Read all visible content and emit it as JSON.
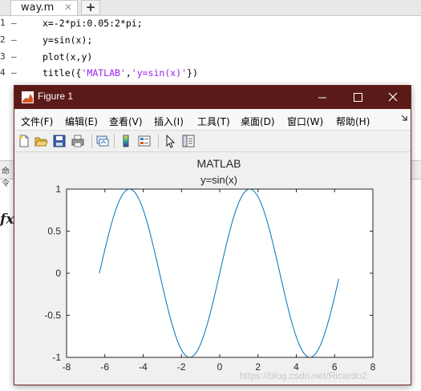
{
  "editor": {
    "tab": {
      "label": "way.m",
      "close": "✕",
      "add": "+"
    },
    "lines": [
      {
        "num": "1",
        "dash": "–",
        "code": "x=-2*pi:0.05:2*pi;"
      },
      {
        "num": "2",
        "dash": "–",
        "code": "y=sin(x);"
      },
      {
        "num": "3",
        "dash": "–",
        "code": "plot(x,y)"
      },
      {
        "num": "4",
        "dash": "–",
        "code_pre": "title({",
        "code_str1": "'MATLAB'",
        "code_mid": ",",
        "code_str2": "'y=sin(x)'",
        "code_post": "})"
      }
    ],
    "command_label": "命令",
    "fx": "fx"
  },
  "figure": {
    "title": "Figure 1",
    "menu": [
      "文件(F)",
      "编辑(E)",
      "查看(V)",
      "插入(I)",
      "工具(T)",
      "桌面(D)",
      "窗口(W)",
      "帮助(H)"
    ],
    "toolbar_icons": [
      "new-figure-icon",
      "open-file-icon",
      "save-icon",
      "print-icon",
      "link-plot-icon",
      "insert-colorbar-icon",
      "insert-legend-icon",
      "select-arrow-icon",
      "property-inspector-icon"
    ],
    "colors": {
      "titlebar": "#5a1a17",
      "line": "#0072bd"
    }
  },
  "chart_data": {
    "type": "line",
    "title": [
      "MATLAB",
      "y=sin(x)"
    ],
    "xlabel": "",
    "ylabel": "",
    "xlim": [
      -8,
      8
    ],
    "ylim": [
      -1,
      1
    ],
    "x_ticks": [
      -8,
      -6,
      -4,
      -2,
      0,
      2,
      4,
      6,
      8
    ],
    "y_ticks": [
      -1,
      -0.5,
      0,
      0.5,
      1
    ],
    "x_tick_labels": [
      "-8",
      "-6",
      "-4",
      "-2",
      "0",
      "2",
      "4",
      "6",
      "8"
    ],
    "y_tick_labels": [
      "-1",
      "-0.5",
      "0",
      "0.5",
      "1"
    ],
    "grid": false,
    "series": [
      {
        "function": "y=sin(x)",
        "x_start": -6.2832,
        "x_end": 6.25,
        "x_step": 0.05,
        "color": "#0072bd"
      }
    ]
  },
  "watermark": "https://blog.csdn.net/Ricardo2"
}
